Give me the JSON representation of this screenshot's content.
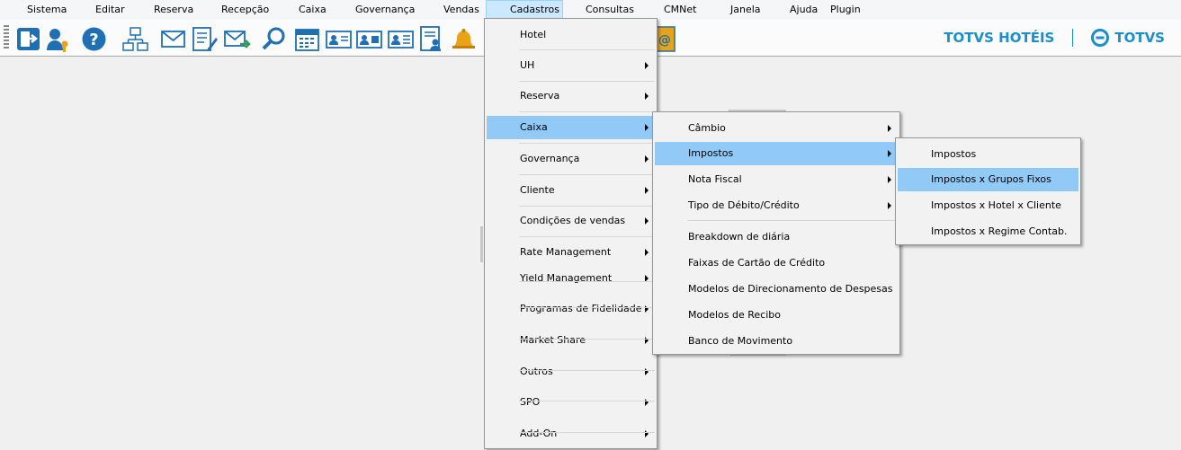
{
  "menubar": [
    {
      "id": "sistema",
      "label": "Sistema"
    },
    {
      "id": "editar",
      "label": "Editar"
    },
    {
      "id": "reserva",
      "label": "Reserva"
    },
    {
      "id": "recepcao",
      "label": "Recepção"
    },
    {
      "id": "caixa",
      "label": "Caixa"
    },
    {
      "id": "governanca",
      "label": "Governança"
    },
    {
      "id": "vendas",
      "label": "Vendas"
    },
    {
      "id": "cadastros",
      "label": "Cadastros"
    },
    {
      "id": "consultas",
      "label": "Consultas"
    },
    {
      "id": "cmnet",
      "label": "CMNet"
    },
    {
      "id": "janela",
      "label": "Janela"
    },
    {
      "id": "ajuda",
      "label": "Ajuda"
    },
    {
      "id": "plugin",
      "label": "Plugin"
    }
  ],
  "brand": {
    "name": "TOTVS HOTÉIS",
    "logo_text": "TOTVS",
    "color": "#1a8fc9"
  },
  "toolbar_icons": [
    "logout-icon",
    "user-key-icon",
    "help-icon",
    "network-icon",
    "mail-icon",
    "form-edit-icon",
    "mail-forward-icon",
    "search-icon",
    "calendar-icon",
    "guest-card-icon",
    "guest-card-alt-icon",
    "card-list-icon",
    "user-document-icon",
    "bell-icon",
    "footprints-icon",
    "contact-book-icon"
  ],
  "cadastros_menu": {
    "items": [
      {
        "label": "Hotel",
        "submenu": false
      },
      {
        "label": "UH",
        "submenu": true
      },
      {
        "label": "Reserva",
        "submenu": true
      },
      {
        "label": "Caixa",
        "submenu": true,
        "highlighted": true
      },
      {
        "label": "Governança",
        "submenu": true
      },
      {
        "label": "Cliente",
        "submenu": true
      },
      {
        "label": "Condições de vendas",
        "submenu": true
      },
      {
        "label": "Rate Management",
        "submenu": true
      },
      {
        "label": "Yield Management",
        "submenu": true
      },
      {
        "label": "Programas de Fidelidade",
        "submenu": true
      },
      {
        "label": "Market Share",
        "submenu": true
      },
      {
        "label": "Outros",
        "submenu": true
      },
      {
        "label": "SPO",
        "submenu": true
      },
      {
        "label": "Add-On",
        "submenu": true
      }
    ]
  },
  "caixa_menu": {
    "items": [
      {
        "label": "Câmbio",
        "submenu": true
      },
      {
        "label": "Impostos",
        "submenu": true,
        "highlighted": true
      },
      {
        "label": "Nota Fiscal",
        "submenu": true
      },
      {
        "label": "Tipo de Débito/Crédito",
        "submenu": true
      },
      {
        "label": "Breakdown de diária",
        "submenu": false
      },
      {
        "label": "Faixas de Cartão de Crédito",
        "submenu": false
      },
      {
        "label": "Modelos de Direcionamento de Despesas",
        "submenu": false
      },
      {
        "label": "Modelos de Recibo",
        "submenu": false
      },
      {
        "label": "Banco de Movimento",
        "submenu": false
      }
    ]
  },
  "impostos_menu": {
    "items": [
      {
        "label": "Impostos"
      },
      {
        "label": "Impostos x Grupos Fixos",
        "highlighted": true
      },
      {
        "label": "Impostos x Hotel x Cliente"
      },
      {
        "label": "Impostos x Regime Contab."
      }
    ]
  },
  "colors": {
    "highlight": "#91c9f7",
    "menu_bg": "#f2f2f2",
    "open_menu": "#cce8ff"
  }
}
